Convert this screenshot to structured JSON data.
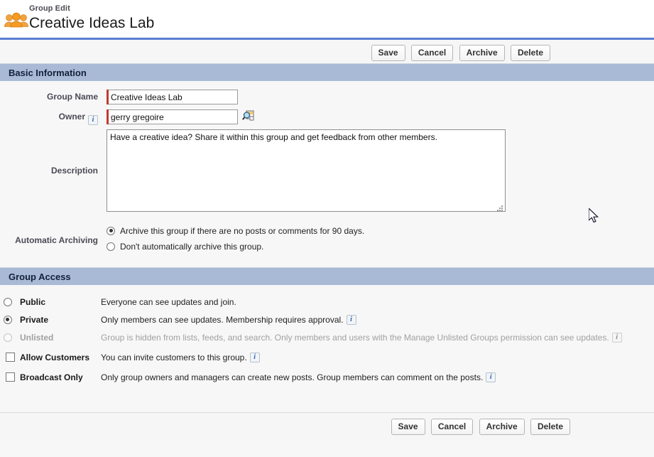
{
  "header": {
    "icon": "group-people-icon",
    "eyebrow": "Group Edit",
    "title": "Creative Ideas Lab"
  },
  "toolbar": {
    "save_label": "Save",
    "cancel_label": "Cancel",
    "archive_label": "Archive",
    "delete_label": "Delete"
  },
  "basic_information": {
    "section_title": "Basic Information",
    "group_name": {
      "label": "Group Name",
      "value": "Creative Ideas Lab",
      "required": true
    },
    "owner": {
      "label": "Owner",
      "value": "gerry gregoire",
      "required": true,
      "info_icon": "info-icon",
      "lookup_icon": "lookup-magnifier-icon"
    },
    "description": {
      "label": "Description",
      "value": "Have a creative idea? Share it within this group and get feedback from other members."
    },
    "automatic_archiving": {
      "label": "Automatic Archiving",
      "options": [
        {
          "label": "Archive this group if there are no posts or comments for 90 days.",
          "selected": true
        },
        {
          "label": "Don't automatically archive this group.",
          "selected": false
        }
      ]
    }
  },
  "group_access": {
    "section_title": "Group Access",
    "options": [
      {
        "name": "Public",
        "description": "Everyone can see updates and join.",
        "type": "radio",
        "selected": false,
        "disabled": false,
        "has_info": false
      },
      {
        "name": "Private",
        "description": "Only members can see updates. Membership requires approval.",
        "type": "radio",
        "selected": true,
        "disabled": false,
        "has_info": true
      },
      {
        "name": "Unlisted",
        "description": "Group is hidden from lists, feeds, and search. Only members and users with the Manage Unlisted Groups permission can see updates.",
        "type": "radio",
        "selected": false,
        "disabled": true,
        "has_info": true
      },
      {
        "name": "Allow Customers",
        "description": "You can invite customers to this group.",
        "type": "checkbox",
        "selected": false,
        "disabled": false,
        "has_info": true
      },
      {
        "name": "Broadcast Only",
        "description": "Only group owners and managers can create new posts. Group members can comment on the posts.",
        "type": "checkbox",
        "selected": false,
        "disabled": false,
        "has_info": true
      }
    ]
  },
  "colors": {
    "header_rule": "#5a7ed0",
    "section_band": "#a8bad6",
    "required_mark": "#c23934",
    "info_icon_text": "#2a63b0",
    "page_background": "#f7f7f7"
  }
}
